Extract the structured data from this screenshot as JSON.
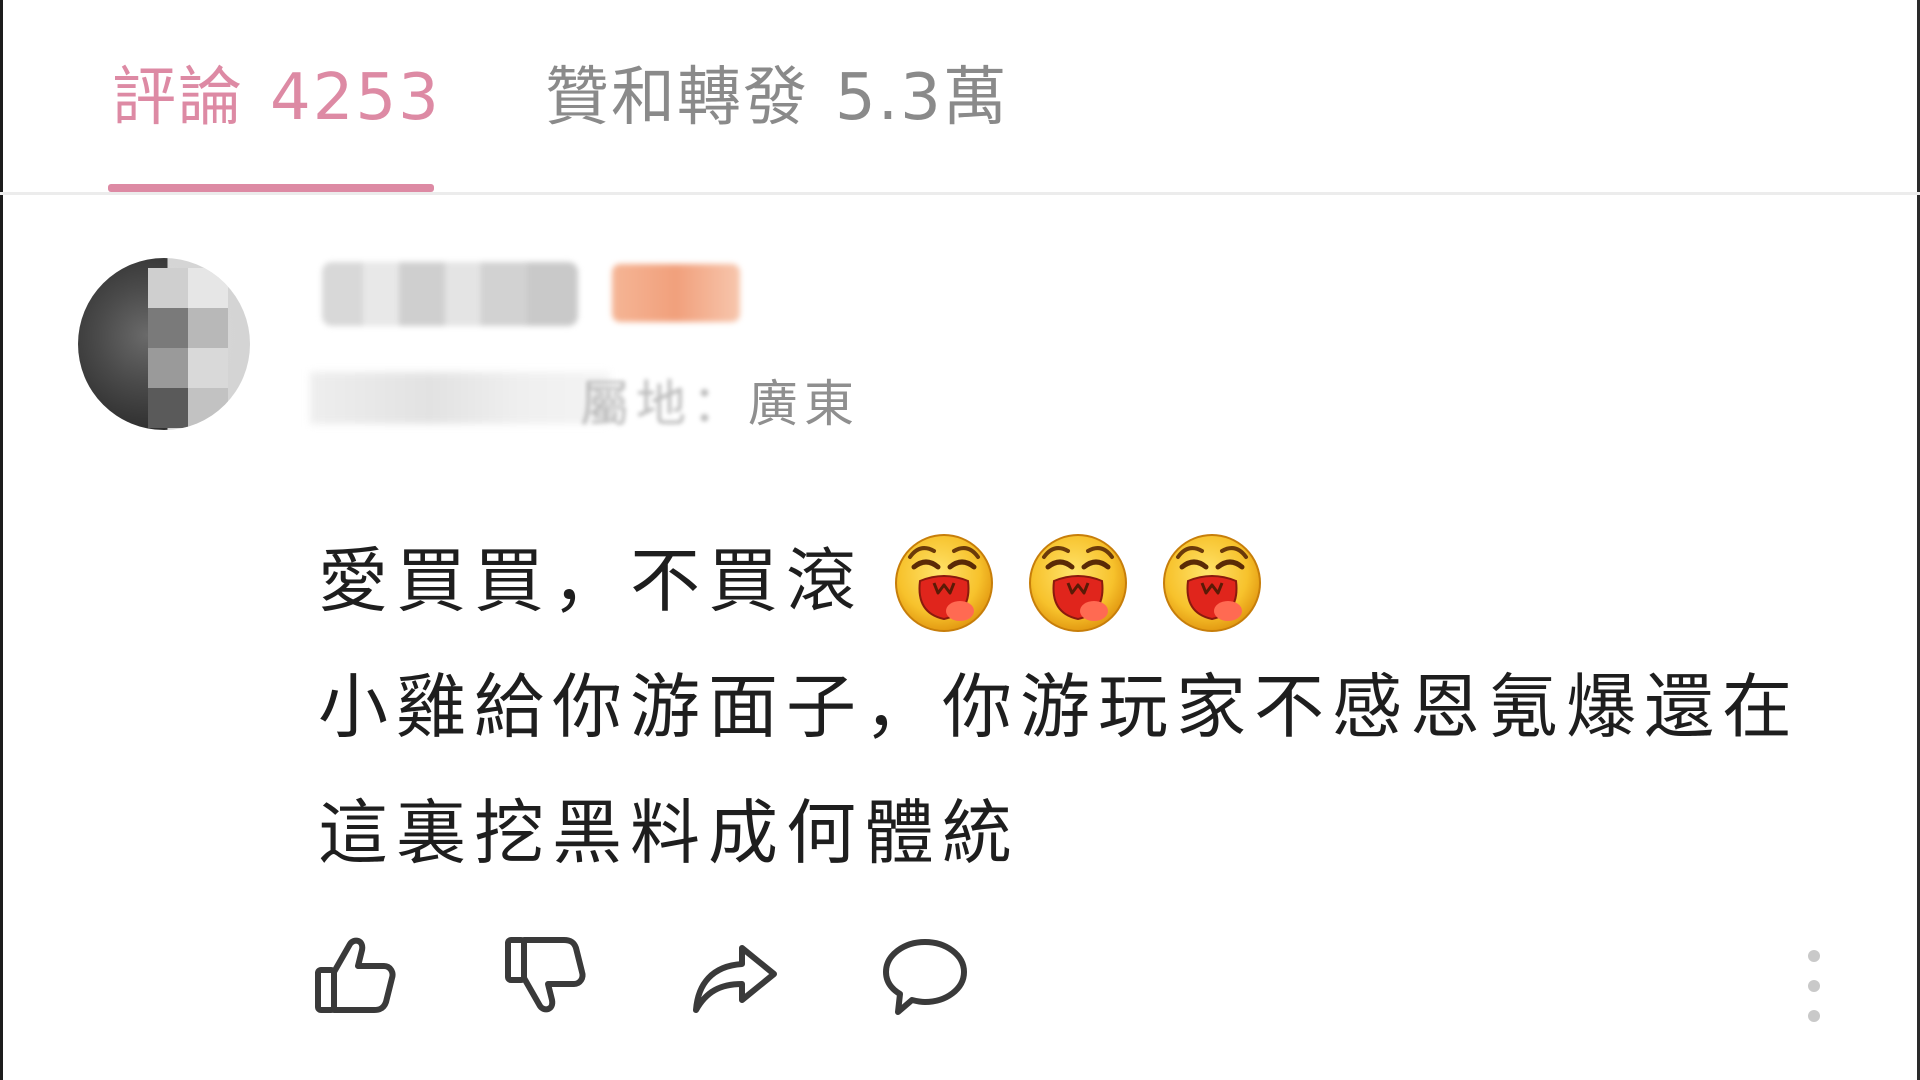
{
  "tabs": {
    "comments": {
      "label": "評論",
      "count": "4253"
    },
    "likes_reposts": {
      "label": "贊和轉發",
      "count": "5.3萬"
    }
  },
  "comment": {
    "meta_label": "屬地：",
    "location": "廣東",
    "lines": [
      "愛買買，不買滾",
      "小雞給你游面子，你游玩家不感恩氪爆還在",
      "這裏挖黑料成何體統"
    ],
    "emojis": [
      "laughing-face-emoji",
      "laughing-face-emoji",
      "laughing-face-emoji"
    ]
  },
  "actions": {
    "icons": [
      "thumbs-up-icon",
      "thumbs-down-icon",
      "share-icon",
      "reply-icon",
      "more-vertical-icon"
    ]
  },
  "colors": {
    "accent_pink": "#dd8aa4",
    "inactive_tab": "#8a8a8a",
    "icon_stroke": "#3a3a3a"
  }
}
